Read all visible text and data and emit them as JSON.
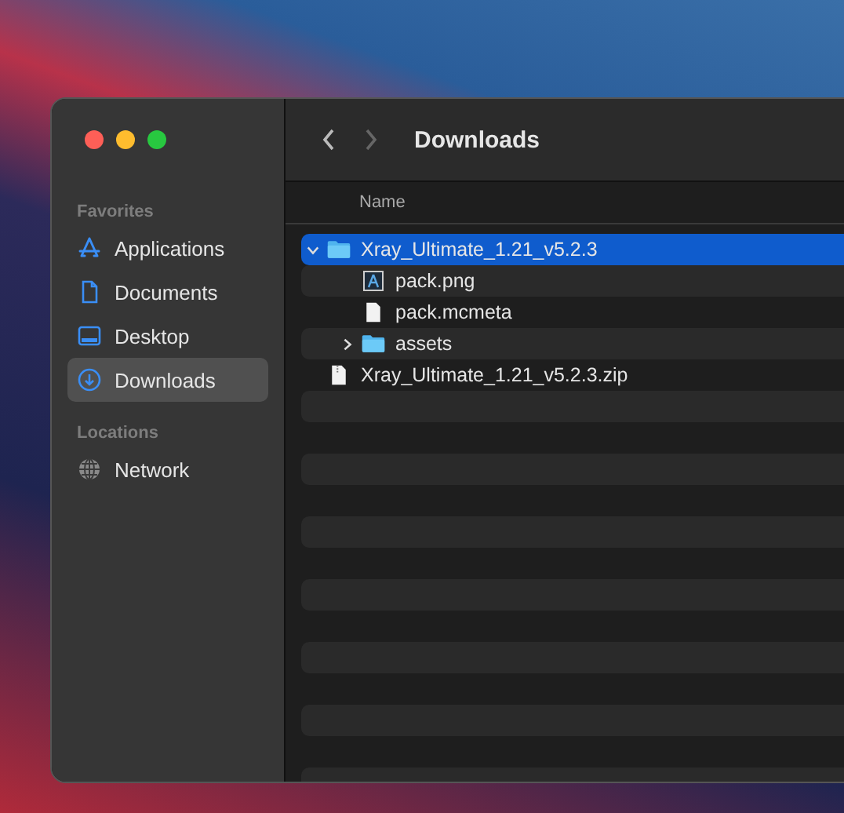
{
  "sidebar": {
    "sections": [
      {
        "heading": "Favorites",
        "items": [
          {
            "label": "Applications",
            "kind": "apps",
            "selected": false
          },
          {
            "label": "Documents",
            "kind": "doc",
            "selected": false
          },
          {
            "label": "Desktop",
            "kind": "desktop",
            "selected": false
          },
          {
            "label": "Downloads",
            "kind": "download",
            "selected": true
          }
        ]
      },
      {
        "heading": "Locations",
        "items": [
          {
            "label": "Network",
            "kind": "network",
            "selected": false
          }
        ]
      }
    ]
  },
  "toolbar": {
    "title": "Downloads"
  },
  "table": {
    "columns": [
      "Name"
    ],
    "rows": [
      {
        "name": "Xray_Ultimate_1.21_v5.2.3",
        "kind": "folder",
        "expanded": true,
        "selected": true,
        "children": [
          {
            "name": "pack.png",
            "kind": "image",
            "selected": false
          },
          {
            "name": "pack.mcmeta",
            "kind": "document",
            "selected": false
          },
          {
            "name": "assets",
            "kind": "folder",
            "expanded": false,
            "selected": false
          }
        ]
      },
      {
        "name": "Xray_Ultimate_1.21_v5.2.3.zip",
        "kind": "archive",
        "selected": false
      }
    ]
  }
}
